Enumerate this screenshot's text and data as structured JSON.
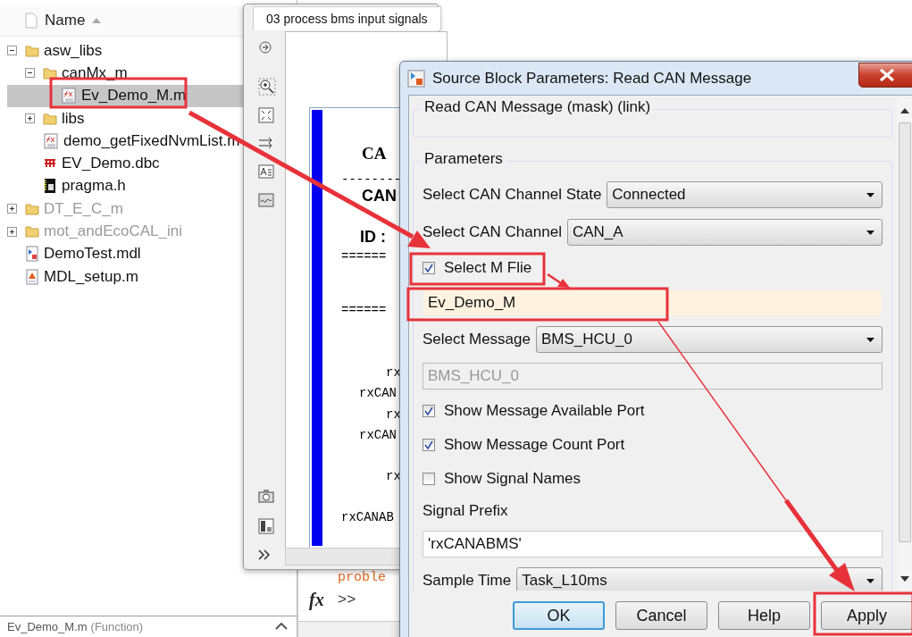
{
  "file_browser": {
    "column_header": "Name",
    "items": [
      {
        "name": "asw_libs",
        "kind": "folder",
        "expanded": true,
        "selected": false,
        "dimmed": false,
        "children": [
          {
            "name": "canMx_m",
            "kind": "folder",
            "expanded": true,
            "selected": false,
            "dimmed": false,
            "children": [
              {
                "name": "Ev_Demo_M.m",
                "kind": "function",
                "selected": true,
                "dimmed": false
              }
            ]
          },
          {
            "name": "libs",
            "kind": "folder",
            "expanded": false,
            "selected": false,
            "dimmed": false
          },
          {
            "name": "demo_getFixedNvmList.m",
            "kind": "function",
            "selected": false,
            "dimmed": false
          },
          {
            "name": "EV_Demo.dbc",
            "kind": "database",
            "selected": false,
            "dimmed": false
          },
          {
            "name": "pragma.h",
            "kind": "header",
            "selected": false,
            "dimmed": false
          }
        ]
      },
      {
        "name": "DT_E_C_m",
        "kind": "folder",
        "expanded": false,
        "selected": false,
        "dimmed": true
      },
      {
        "name": "mot_andEcoCAL_ini",
        "kind": "folder",
        "expanded": false,
        "selected": false,
        "dimmed": true
      },
      {
        "name": "DemoTest.mdl",
        "kind": "model",
        "selected": false,
        "dimmed": false
      },
      {
        "name": "MDL_setup.m",
        "kind": "script",
        "selected": false,
        "dimmed": false
      }
    ],
    "status": {
      "name": "Ev_Demo_M.m",
      "type": "(Function)"
    }
  },
  "model_window": {
    "tab": "03 process bms input signals",
    "block_lines": [
      {
        "text": "CA",
        "kind": "title"
      },
      {
        "text": "--------",
        "kind": "rule"
      },
      {
        "text": "CAN",
        "kind": "heading"
      },
      {
        "text": "ID :",
        "kind": "heading"
      },
      {
        "text": "======",
        "kind": "rule"
      },
      {
        "text": "======",
        "kind": "rule"
      },
      {
        "text": "rx",
        "kind": "port"
      },
      {
        "text": "rxCAN",
        "kind": "port"
      },
      {
        "text": "rx",
        "kind": "port"
      },
      {
        "text": "rxCAN",
        "kind": "port"
      },
      {
        "text": "rx",
        "kind": "port"
      },
      {
        "text": "rxCANAB",
        "kind": "port"
      }
    ]
  },
  "command_window": {
    "output": "proble",
    "function_button": "fx",
    "prompt": ">>"
  },
  "dialog": {
    "title": "Source Block Parameters: Read CAN Message",
    "description_group": "Read CAN Message (mask) (link)",
    "parameters_group": "Parameters",
    "parameters": [
      {
        "kind": "select",
        "label": "Select CAN Channel State",
        "value": "Connected"
      },
      {
        "kind": "select",
        "label": "Select CAN Channel",
        "value": "CAN_A"
      },
      {
        "kind": "checkbox",
        "label": "Select M Flie",
        "checked": true
      },
      {
        "kind": "field",
        "value": "Ev_Demo_M",
        "disabled": false,
        "tinted": true
      },
      {
        "kind": "select",
        "label": "Select Message",
        "value": "BMS_HCU_0"
      },
      {
        "kind": "field",
        "value": "BMS_HCU_0",
        "disabled": true,
        "tinted": false
      },
      {
        "kind": "checkbox",
        "label": "Show Message Available Port",
        "checked": true
      },
      {
        "kind": "checkbox",
        "label": "Show Message Count Port",
        "checked": true
      },
      {
        "kind": "checkbox",
        "label": "Show Signal Names",
        "checked": false
      },
      {
        "kind": "label",
        "label": "Signal Prefix"
      },
      {
        "kind": "field",
        "value": "'rxCANABMS'",
        "disabled": false,
        "tinted": false
      },
      {
        "kind": "select",
        "label": "Sample Time",
        "value": "Task_L10ms"
      }
    ],
    "buttons": [
      {
        "label": "OK",
        "default": true
      },
      {
        "label": "Cancel",
        "default": false
      },
      {
        "label": "Help",
        "default": false
      },
      {
        "label": "Apply",
        "default": false
      }
    ]
  }
}
